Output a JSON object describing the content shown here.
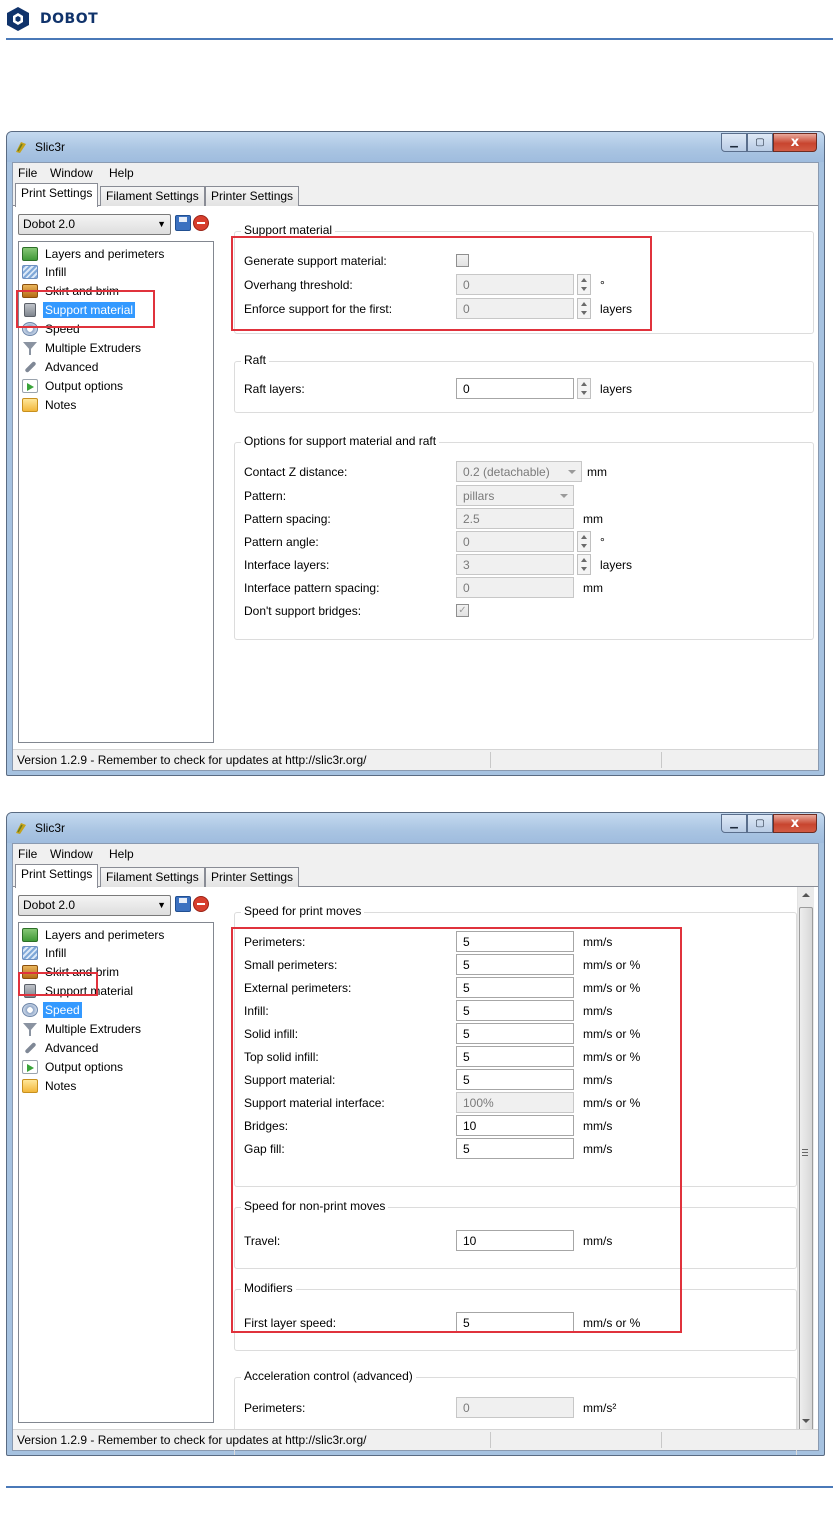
{
  "doc": {
    "brand": "DOBOT"
  },
  "window1": {
    "title": "Slic3r",
    "menu": [
      "File",
      "Window",
      "Help"
    ],
    "tabs": [
      "Print Settings",
      "Filament Settings",
      "Printer Settings"
    ],
    "preset": "Dobot 2.0",
    "tree": [
      {
        "label": "Layers and perimeters",
        "icon": "layers-icon"
      },
      {
        "label": "Infill",
        "icon": "infill-icon"
      },
      {
        "label": "Skirt and brim",
        "icon": "skirt-icon"
      },
      {
        "label": "Support material",
        "icon": "support-icon"
      },
      {
        "label": "Speed",
        "icon": "speed-icon"
      },
      {
        "label": "Multiple Extruders",
        "icon": "funnel-icon"
      },
      {
        "label": "Advanced",
        "icon": "wrench-icon"
      },
      {
        "label": "Output options",
        "icon": "output-icon"
      },
      {
        "label": "Notes",
        "icon": "notes-icon"
      }
    ],
    "groups": {
      "support": {
        "title": "Support material",
        "generate_label": "Generate support material:",
        "overhang_label": "Overhang threshold:",
        "overhang_value": "0",
        "overhang_unit": "°",
        "enforce_label": "Enforce support for the first:",
        "enforce_value": "0",
        "enforce_unit": "layers"
      },
      "raft": {
        "title": "Raft",
        "raft_label": "Raft layers:",
        "raft_value": "0",
        "raft_unit": "layers"
      },
      "options": {
        "title": "Options for support material and raft",
        "contact_label": "Contact Z distance:",
        "contact_value": "0.2 (detachable)",
        "contact_unit": "mm",
        "pattern_label": "Pattern:",
        "pattern_value": "pillars",
        "spacing_label": "Pattern spacing:",
        "spacing_value": "2.5",
        "spacing_unit": "mm",
        "angle_label": "Pattern angle:",
        "angle_value": "0",
        "angle_unit": "°",
        "interface_label": "Interface layers:",
        "interface_value": "3",
        "interface_unit": "layers",
        "ispacing_label": "Interface pattern spacing:",
        "ispacing_value": "0",
        "ispacing_unit": "mm",
        "bridges_label": "Don't support bridges:"
      }
    },
    "status": "Version 1.2.9 - Remember to check for updates at http://slic3r.org/"
  },
  "window2": {
    "title": "Slic3r",
    "menu": [
      "File",
      "Window",
      "Help"
    ],
    "tabs": [
      "Print Settings",
      "Filament Settings",
      "Printer Settings"
    ],
    "preset": "Dobot 2.0",
    "tree": [
      {
        "label": "Layers and perimeters"
      },
      {
        "label": "Infill"
      },
      {
        "label": "Skirt and brim"
      },
      {
        "label": "Support material"
      },
      {
        "label": "Speed"
      },
      {
        "label": "Multiple Extruders"
      },
      {
        "label": "Advanced"
      },
      {
        "label": "Output options"
      },
      {
        "label": "Notes"
      }
    ],
    "print_moves": {
      "title": "Speed for print moves",
      "rows": [
        {
          "label": "Perimeters:",
          "value": "5",
          "unit": "mm/s"
        },
        {
          "label": "Small perimeters:",
          "value": "5",
          "unit": "mm/s or %"
        },
        {
          "label": "External perimeters:",
          "value": "5",
          "unit": "mm/s or %"
        },
        {
          "label": "Infill:",
          "value": "5",
          "unit": "mm/s"
        },
        {
          "label": "Solid infill:",
          "value": "5",
          "unit": "mm/s or %"
        },
        {
          "label": "Top solid infill:",
          "value": "5",
          "unit": "mm/s or %"
        },
        {
          "label": "Support material:",
          "value": "5",
          "unit": "mm/s"
        },
        {
          "label": "Support material interface:",
          "value": "100%",
          "unit": "mm/s or %"
        },
        {
          "label": "Bridges:",
          "value": "10",
          "unit": "mm/s"
        },
        {
          "label": "Gap fill:",
          "value": "5",
          "unit": "mm/s"
        }
      ]
    },
    "non_print": {
      "title": "Speed for non-print moves",
      "label": "Travel:",
      "value": "10",
      "unit": "mm/s"
    },
    "modifiers": {
      "title": "Modifiers",
      "label": "First layer speed:",
      "value": "5",
      "unit": "mm/s or %"
    },
    "accel": {
      "title": "Acceleration control (advanced)",
      "label": "Perimeters:",
      "value": "0",
      "unit": "mm/s²"
    },
    "status": "Version 1.2.9 - Remember to check for updates at http://slic3r.org/"
  },
  "colors": {
    "highlight": "#e0323c",
    "selection": "#3399ff",
    "brand": "#10336b"
  }
}
